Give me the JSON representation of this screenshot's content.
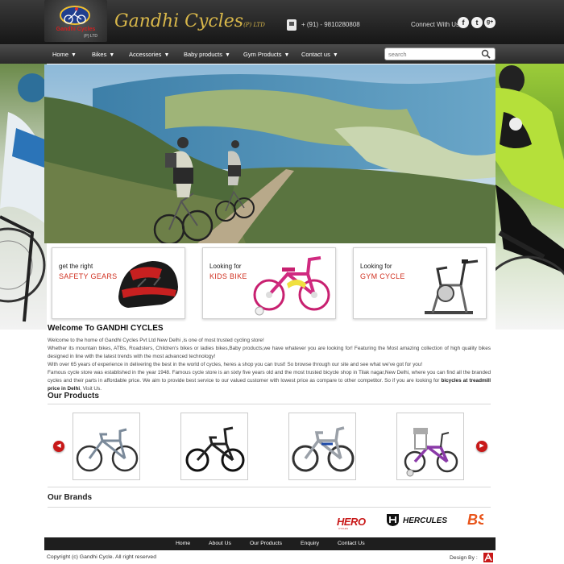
{
  "header": {
    "logo_text": "Gandhi Cycles",
    "logo_sub": "(P) LTD",
    "title": "Gandhi Cycles",
    "title_suffix": "(P) LTD",
    "phone": "+ (91) - 9810280808",
    "connect_label": "Connect With Us",
    "social": [
      {
        "icon": "facebook-icon",
        "glyph": "f"
      },
      {
        "icon": "twitter-icon",
        "glyph": "t"
      },
      {
        "icon": "google-plus-icon",
        "glyph": "g+"
      }
    ]
  },
  "nav": {
    "items": [
      {
        "label": "Home"
      },
      {
        "label": "Bikes"
      },
      {
        "label": "Accessories"
      },
      {
        "label": "Baby products"
      },
      {
        "label": "Gym Products"
      },
      {
        "label": "Contact us"
      }
    ],
    "search_placeholder": "search"
  },
  "promos": [
    {
      "line1": "get the right",
      "line2": "SAFETY GEARS"
    },
    {
      "line1": "Looking for",
      "line2": "KIDS BIKE"
    },
    {
      "line1": "Looking for",
      "line2": "GYM CYCLE"
    }
  ],
  "welcome": {
    "title": "Welcome To GANDHI CYCLES",
    "p1": "Welcome to the home of Gandhi Cycles Pvt Ltd New Delhi ,is one of most trusted cycling store!",
    "p2": "Whether its mountain bikes, ATBs, Roadsters, Children's bikes or ladies bikes,Baby products,we have whatever you are looking for! Featuring the Most amazing collection of high quality bikes designed in line with the latest trends with the most advanced technology!",
    "p3": "With over 65 years of experience in delivering the best in the world of cycles, heres a shop you can trust! So browse through our site and see what we've got for you!",
    "p4": "Famous cycle store was established in the year 1948. Famous cycle store is an sixty five years old and the most trusted bicycle shop in Tilak nagar,New Delhi, where you can find all the branded cycles and their parts in affordable price. We aim to provide best service to our valued customer with lowest price as compare to other competitor. So if you are looking for",
    "p4_bold": "bicycles at treadmill price in Delhi",
    "p4_end": ", Visit Us."
  },
  "products": {
    "title": "Our Products",
    "items": [
      {
        "name": "mountain-bike"
      },
      {
        "name": "bmx-bike"
      },
      {
        "name": "junior-bike"
      },
      {
        "name": "kids-bike"
      }
    ],
    "prev_glyph": "◀",
    "next_glyph": "▶"
  },
  "brands": {
    "title": "Our Brands",
    "items": [
      {
        "label": "HERO",
        "sub": "CYCLES"
      },
      {
        "label": "HERCULES"
      },
      {
        "label": "BSA"
      }
    ]
  },
  "footer": {
    "links": [
      {
        "label": "Home"
      },
      {
        "label": "About Us"
      },
      {
        "label": "Our Products"
      },
      {
        "label": "Enquiry"
      },
      {
        "label": "Contact Us"
      }
    ],
    "copyright": "Copyright (c) Gandhi Cycle. All right reserved",
    "design_by": "Design By :"
  },
  "colors": {
    "accent_red": "#c81818",
    "title_gold": "#d8b74a",
    "header_dark": "#1e1e1e",
    "promo_red": "#d03020"
  }
}
